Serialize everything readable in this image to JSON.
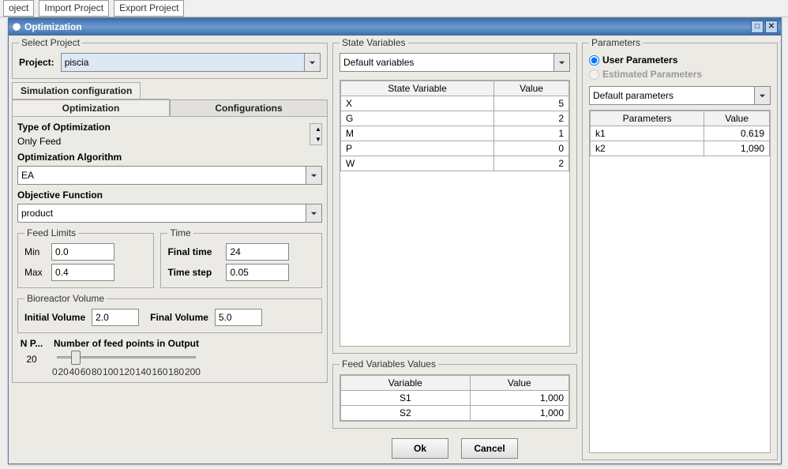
{
  "topbar": {
    "project_btn": "oject",
    "import_btn": "Import Project",
    "export_btn": "Export Project"
  },
  "window": {
    "title": "Optimization"
  },
  "select_project": {
    "legend": "Select Project",
    "label": "Project:",
    "value": "piscia"
  },
  "sim_config_label": "Simulation configuration",
  "tabs": {
    "opt": "Optimization",
    "conf": "Configurations"
  },
  "type_opt": {
    "label": "Type of Optimization",
    "value": "Only Feed"
  },
  "algo": {
    "label": "Optimization Algorithm",
    "value": "EA"
  },
  "objfn": {
    "label": "Objective Function",
    "value": "product"
  },
  "feed_limits": {
    "legend": "Feed Limits",
    "min_label": "Min",
    "min": "0.0",
    "max_label": "Max",
    "max": "0.4"
  },
  "time": {
    "legend": "Time",
    "final_label": "Final time",
    "final": "24",
    "step_label": "Time step",
    "step": "0.05"
  },
  "bioreactor": {
    "legend": "Bioreactor Volume",
    "init_label": "Initial Volume",
    "init": "2.0",
    "final_label": "Final Volume",
    "final": "5.0"
  },
  "npoints": {
    "short_label": "N P...",
    "caption": "Number of feed points in Output",
    "value": "20",
    "ticks": [
      "0",
      "20",
      "40",
      "60",
      "80",
      "100",
      "120",
      "140",
      "160",
      "180",
      "200"
    ]
  },
  "state_vars": {
    "legend": "State Variables",
    "combo": "Default variables",
    "headers": [
      "State Variable",
      "Value"
    ],
    "rows": [
      [
        "X",
        "5"
      ],
      [
        "G",
        "2"
      ],
      [
        "M",
        "1"
      ],
      [
        "P",
        "0"
      ],
      [
        "W",
        "2"
      ]
    ]
  },
  "feed_vars": {
    "legend": "Feed Variables Values",
    "headers": [
      "Variable",
      "Value"
    ],
    "rows": [
      [
        "S1",
        "1,000"
      ],
      [
        "S2",
        "1,000"
      ]
    ]
  },
  "parameters": {
    "legend": "Parameters",
    "radio_user": "User Parameters",
    "radio_est": "Estimated Parameters",
    "combo": "Default parameters",
    "headers": [
      "Parameters",
      "Value"
    ],
    "rows": [
      [
        "k1",
        "0.619"
      ],
      [
        "k2",
        "1,090"
      ]
    ]
  },
  "buttons": {
    "ok": "Ok",
    "cancel": "Cancel"
  }
}
